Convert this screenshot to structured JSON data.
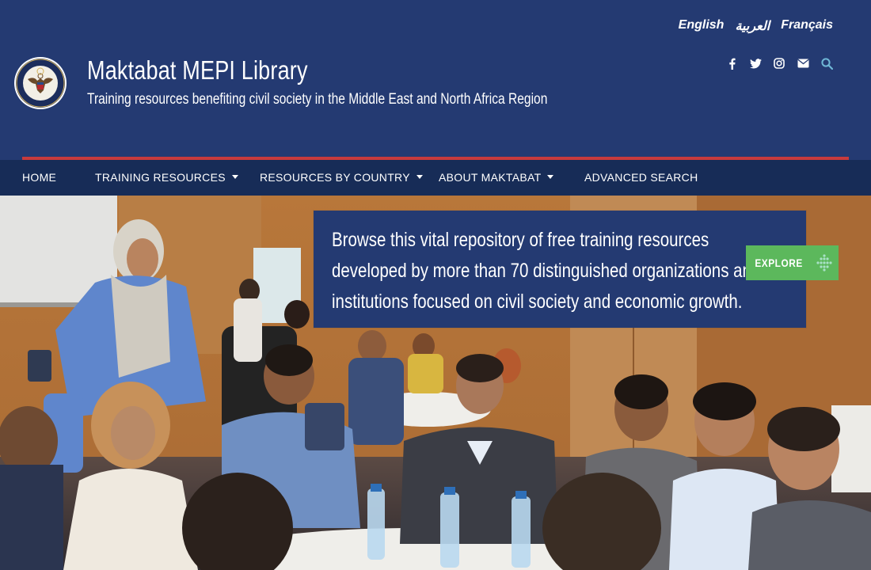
{
  "languages": [
    "English",
    "العربية",
    "Français"
  ],
  "site": {
    "title": "Maktabat MEPI Library",
    "subtitle": "Training resources benefiting civil society in the Middle East and North Africa Region"
  },
  "social_icons": [
    "facebook-icon",
    "twitter-icon",
    "instagram-icon",
    "envelope-icon",
    "search-icon"
  ],
  "nav": {
    "home": "HOME",
    "training_resources": "TRAINING RESOURCES",
    "resources_by_country": "RESOURCES BY COUNTRY",
    "about_maktabat": "ABOUT MAKTABAT",
    "advanced_search": "ADVANCED SEARCH"
  },
  "hero": {
    "text": "Browse this vital repository of free training resources developed by more than 70 distinguished organizations and institutions focused on civil society and economic growth.",
    "explore_label": "EXPLORE"
  },
  "colors": {
    "header_bg": "#243a72",
    "nav_bg": "#172c57",
    "accent_red": "#c83a3c",
    "explore_green": "#5cb85c",
    "search_icon": "#6fb7d6"
  }
}
